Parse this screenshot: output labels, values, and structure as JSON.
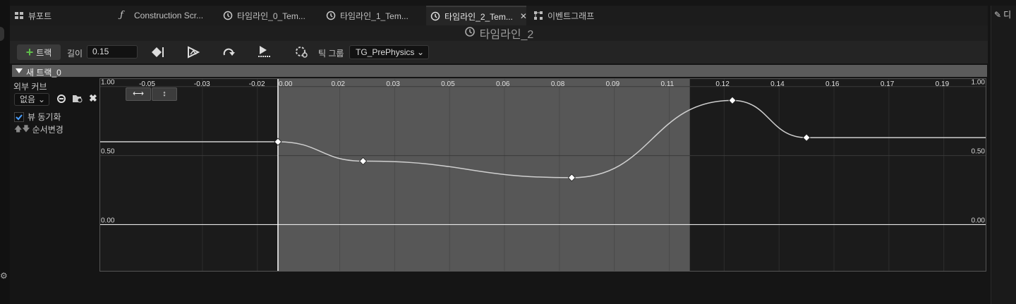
{
  "tabs": [
    {
      "label": "뷰포트",
      "icon": "grid-icon"
    },
    {
      "label": "Construction Scr...",
      "icon": "function-icon"
    },
    {
      "label": "타임라인_0_Tem...",
      "icon": "clock-icon"
    },
    {
      "label": "타임라인_1_Tem...",
      "icon": "clock-icon"
    },
    {
      "label": "타임라인_2_Tem...",
      "icon": "clock-icon",
      "active": true
    },
    {
      "label": "이벤트그래프",
      "icon": "graph-icon"
    }
  ],
  "right_tab_label": "디",
  "title": "타임라인_2",
  "toolbar": {
    "add_track_label": "트랙",
    "length_label": "길이",
    "length_value": "0.15",
    "tick_group_label": "틱 그룹",
    "tick_group_value": "TG_PrePhysics"
  },
  "track": {
    "name": "새 트랙_0",
    "external_curve_label": "외부 커브",
    "external_curve_value": "없음",
    "sync_view_label": "뷰 동기화",
    "sync_view_checked": true,
    "reorder_label": "순서변경"
  },
  "graph": {
    "x_ticks": [
      "-0.05",
      "-0.03",
      "-0.02",
      "0.00",
      "0.02",
      "0.03",
      "0.05",
      "0.06",
      "0.08",
      "0.09",
      "0.11",
      "0.12",
      "0.14",
      "0.16",
      "0.17",
      "0.19"
    ],
    "x_tick_values": [
      -0.0475,
      -0.0275,
      -0.0075,
      0.0,
      0.0225,
      0.0425,
      0.0625,
      0.0825,
      0.1025,
      0.1225,
      0.1425,
      0.1625,
      0.1825,
      0.2025,
      0.2225,
      0.2425
    ],
    "y_ticks": [
      "1.00",
      "0.50",
      "0.00"
    ],
    "y_tick_values": [
      1.0,
      0.5,
      0.0
    ],
    "x_range": [
      -0.065,
      0.258
    ],
    "y_range": [
      -0.34,
      1.06
    ],
    "timeline_range": [
      0.0,
      0.15
    ],
    "keys": [
      {
        "t": 0.0,
        "v": 0.6
      },
      {
        "t": 0.031,
        "v": 0.46
      },
      {
        "t": 0.107,
        "v": 0.34
      },
      {
        "t": 0.1655,
        "v": 0.9
      },
      {
        "t": 0.1925,
        "v": 0.63
      }
    ],
    "colors": {
      "bg_outside": "#1b1b1b",
      "bg_inside": "#575757",
      "curve": "#cfcfcf",
      "grid": "#2d2d2d",
      "grid_inside": "#4a4a4a"
    }
  }
}
